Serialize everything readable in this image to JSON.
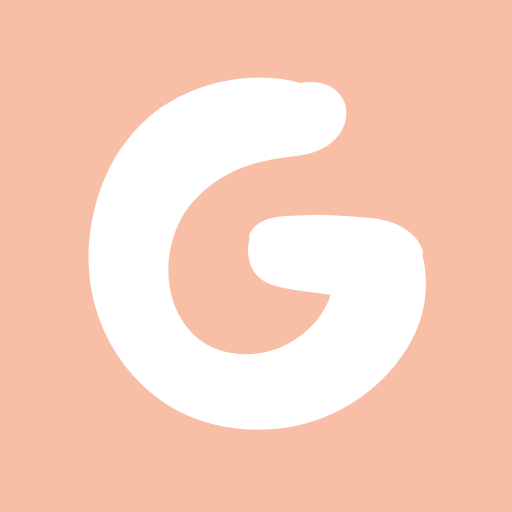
{
  "app_icon": {
    "background_color": "#f9bea6",
    "glyph_color": "#ffffff",
    "logo": {
      "letter": "G",
      "icon": "hand-drawn-letter-g-icon"
    }
  }
}
